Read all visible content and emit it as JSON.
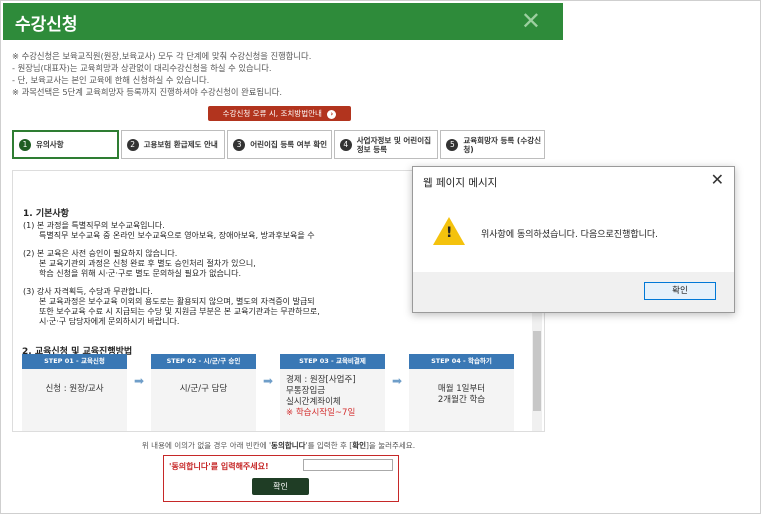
{
  "header": {
    "title": "수강신청",
    "close_icon": "close-icon"
  },
  "notes": [
    "※ 수강신청은 보육교직원(원장,보육교사) 모두 각 단계에 맞춰 수강신청을 진행합니다.",
    "  - 원장님(대표자)는 교육희망과 상관없이 대리수강신청을 하실 수 있습니다.",
    "  - 단, 보육교사는 본인 교육에 한해 신청하실 수 있습니다.",
    "※ 과목선택은 5단계 교육희망자 등록까지 진행하셔야 수강신청이 완료됩니다."
  ],
  "error_button": {
    "label": "수강신청 오류 시, 조치방법안내"
  },
  "tabs": [
    {
      "num": "1",
      "label": "유의사항"
    },
    {
      "num": "2",
      "label": "고용보험 환급제도 안내"
    },
    {
      "num": "3",
      "label": "어린이집 등록 여부 확인"
    },
    {
      "num": "4",
      "label": "사업자정보 및 어린이집 정보 등록"
    },
    {
      "num": "5",
      "label": "교육희망자 등록 (수강신청)"
    }
  ],
  "basics": {
    "heading": "1. 기본사항",
    "item1": "(1)  본 과정을 특별직무의 보수교육입니다.",
    "item1_sub": "특별직무 보수교육 중 온라인 보수교육으로 영아보육, 장애아보육, 방과후보육을 수",
    "item2": "(2)  본 교육은 사전 승인이 필요하지 않습니다.",
    "item2_sub1": "본 교육기관의 과정은 신청 완료 후 별도 승인처리 절차가 있으니,",
    "item2_sub2": "학습 신청을 위해 시·군·구로 별도 문의하실 필요가 없습니다.",
    "item3": "(3)  강사 자격획득, 수당과 무관합니다.",
    "item3_sub1": "본 교육과정은 보수교육 이외의 용도로는 활용되지 않으며, 별도의 자격증이 발급되",
    "item3_sub2": "또한 보수교육 수료 시 지급되는 수당 및 지원금 부분은 본 교육기관과는 무관하므로,",
    "item3_sub3": "시·군·구 담당자에게 문의하시기 바랍니다."
  },
  "section2": {
    "heading": "2. 교육신청 및 교육진행방법"
  },
  "steps": [
    {
      "bar": "STEP 01 - 교육신청",
      "desc": "신청 : 원장/교사"
    },
    {
      "bar": "STEP 02 - 시/군/구 승인",
      "desc": "시/군/구 담당"
    },
    {
      "bar": "STEP 03 - 교육비결제",
      "lines": [
        "경제 : 원장[사업주]",
        "무통장입금",
        "실시간계좌이체"
      ],
      "red": "※ 학습시작일~7일"
    },
    {
      "bar": "STEP 04 - 학습하기",
      "lines": [
        "매월 1일부터",
        "2개월간 학습"
      ]
    }
  ],
  "notice": {
    "prefix": "위 내용에 이의가 없을 경우 아래 빈칸에 '",
    "strong1": "동의합니다",
    "middle": "'를 입력한 후 [",
    "strong2": "확인",
    "suffix": "]을 눌러주세요."
  },
  "agree": {
    "label": "'동의합니다'를 입력해주세요!",
    "input_value": "",
    "button": "확인"
  },
  "dialog": {
    "title": "웹 페이지 메시지",
    "message": "위사항에 동의하셨습니다. 다음으로진행합니다.",
    "ok": "확인",
    "icon": "warning-icon"
  },
  "colors": {
    "header_green": "#2e8b3a",
    "step_blue": "#3a78b5",
    "error_red": "#b2341e"
  }
}
